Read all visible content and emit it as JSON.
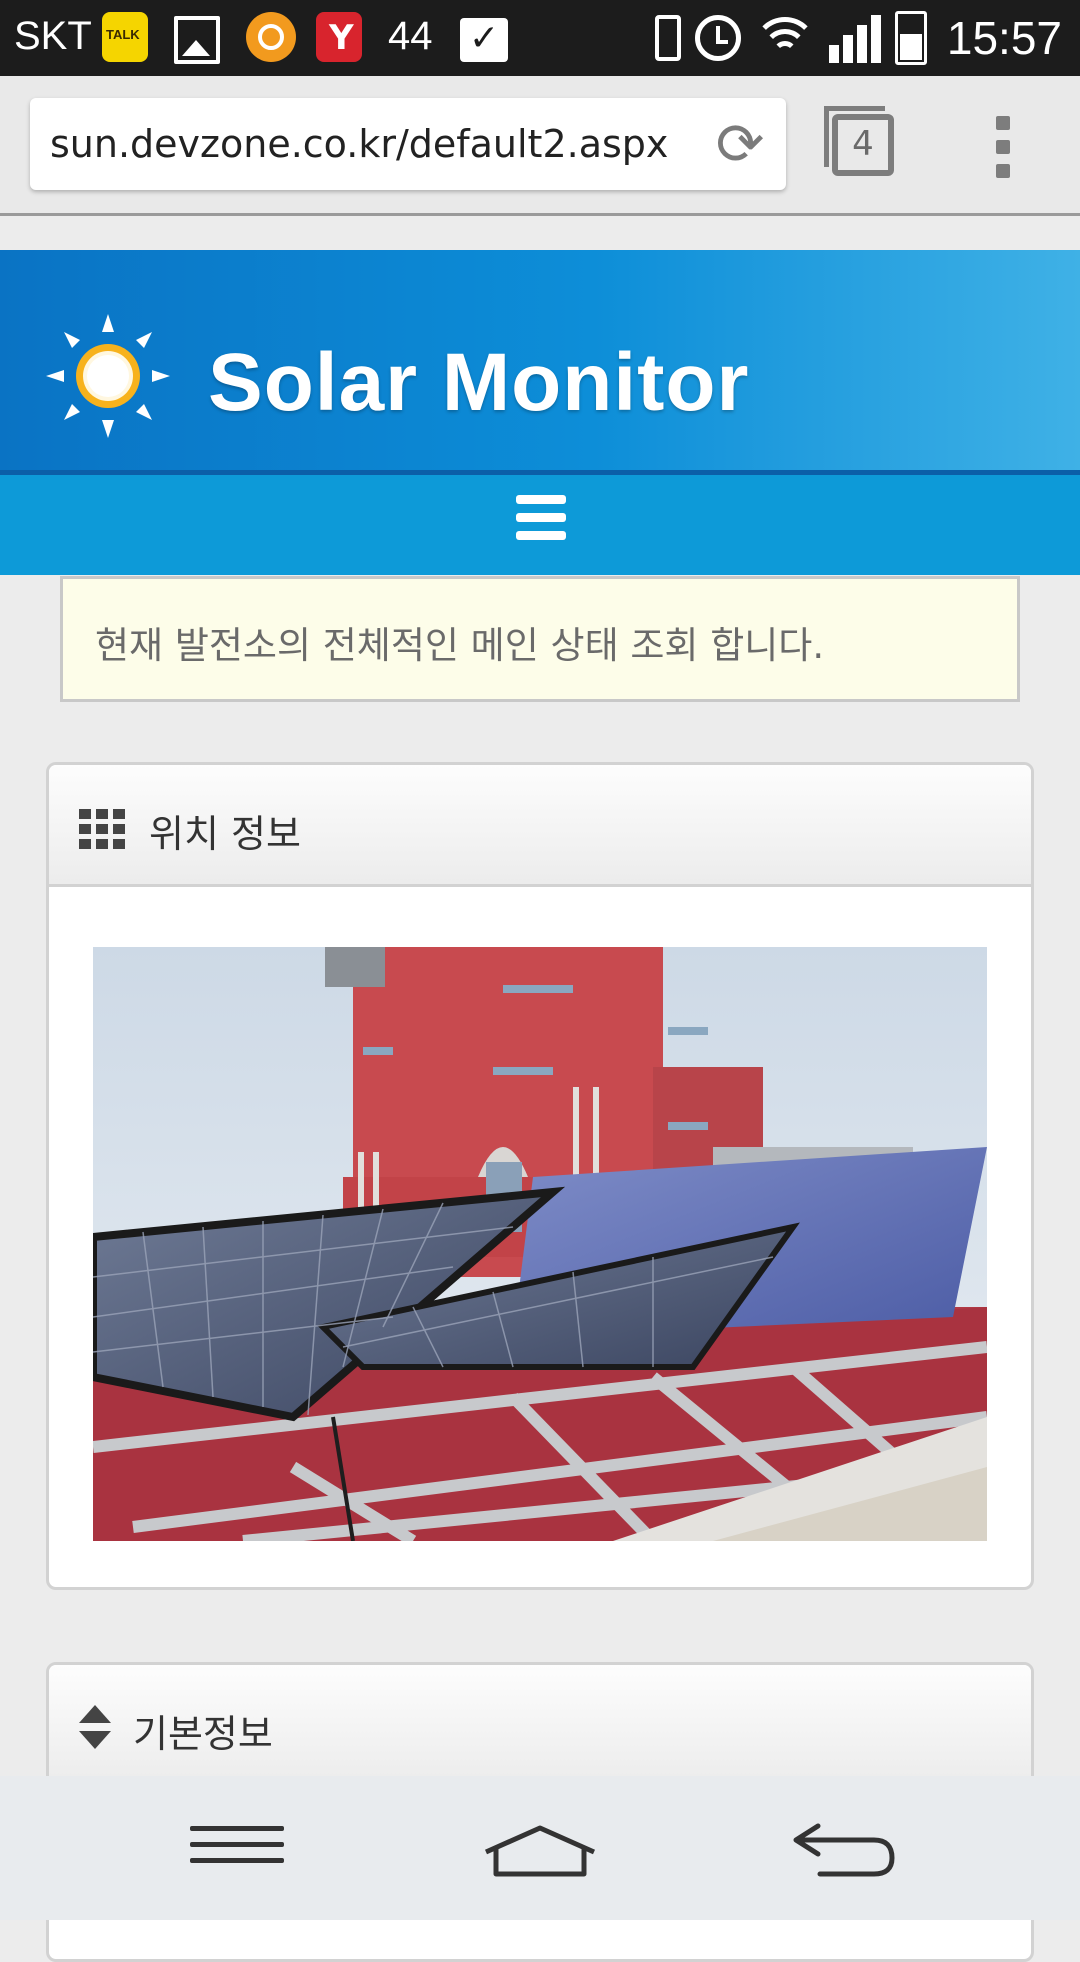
{
  "status_bar": {
    "carrier": "SKT",
    "notification_count": "44",
    "time": "15:57",
    "icons": [
      "kakaotalk-icon",
      "gallery-icon",
      "orange-app-icon",
      "shopping-bag-icon",
      "checked-bag-icon",
      "vibrate-icon",
      "alarm-icon",
      "wifi-icon",
      "signal-icon",
      "battery-icon"
    ]
  },
  "browser": {
    "url": "sun.devzone.co.kr/default2.aspx",
    "tab_count": "4"
  },
  "site": {
    "title": "Solar Monitor"
  },
  "notice": {
    "text": "현재 발전소의 전체적인 메인 상태 조회 합니다."
  },
  "panels": {
    "location": {
      "title": "위치 정보"
    },
    "basic": {
      "title": "기본정보"
    }
  },
  "colors": {
    "banner_blue": "#0a73c4",
    "navbar_blue": "#0d9ad8",
    "notice_bg": "#fdfde9"
  }
}
